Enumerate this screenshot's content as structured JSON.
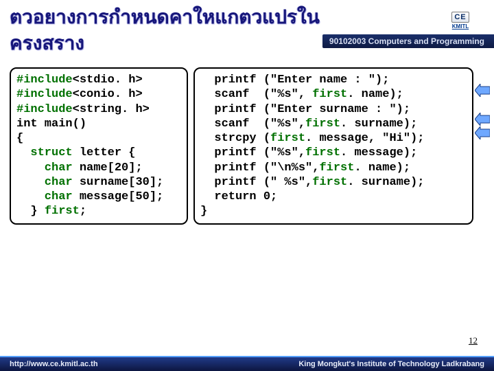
{
  "title": {
    "line1": "ตวอยางการกำหนดคาใหแกตวแปรใน",
    "line2": "ครงสราง"
  },
  "logo": {
    "top": "CE",
    "bottom": "KMITL"
  },
  "course": "90102003 Computers and Programming",
  "code_left": {
    "l1a": "#include",
    "l1b": "<stdio. h>",
    "l2a": "#include",
    "l2b": "<conio. h>",
    "l3a": "#include",
    "l3b": "<string. h>",
    "l4": "int main()",
    "l5": "{",
    "l6a": "  struct",
    "l6b": " letter {",
    "l7a": "    char",
    "l7b": " name[20];",
    "l8a": "    char",
    "l8b": " surname[30];",
    "l9a": "    char",
    "l9b": " message[50];",
    "l10a": "  } ",
    "l10b": "first",
    "l10c": ";"
  },
  "code_right": {
    "r1": "  printf (\"Enter name : \");",
    "r2a": "  scanf  (\"%s\", ",
    "r2b": "first",
    "r2c": ". name);",
    "r3": "  printf (\"Enter surname : \");",
    "r4a": "  scanf  (\"%s\",",
    "r4b": "first",
    "r4c": ". surname);",
    "r5a": "  strcpy (",
    "r5b": "first",
    "r5c": ". message, \"Hi\");",
    "r6a": "  printf (\"%s\",",
    "r6b": "first",
    "r6c": ". message);",
    "r7a": "  printf (\"\\n%s\",",
    "r7b": "first",
    "r7c": ". name);",
    "r8a": "  printf (\" %s\",",
    "r8b": "first",
    "r8c": ". surname);",
    "r9": "  return 0;",
    "r10": "}"
  },
  "pagenum": "12",
  "footer": {
    "left": "http://www.ce.kmitl.ac.th",
    "right": "King Mongkut's Institute of Technology Ladkrabang"
  },
  "colors": {
    "title": "#16167a",
    "footer_bg": "#152a6a",
    "keyword": "#007000"
  }
}
